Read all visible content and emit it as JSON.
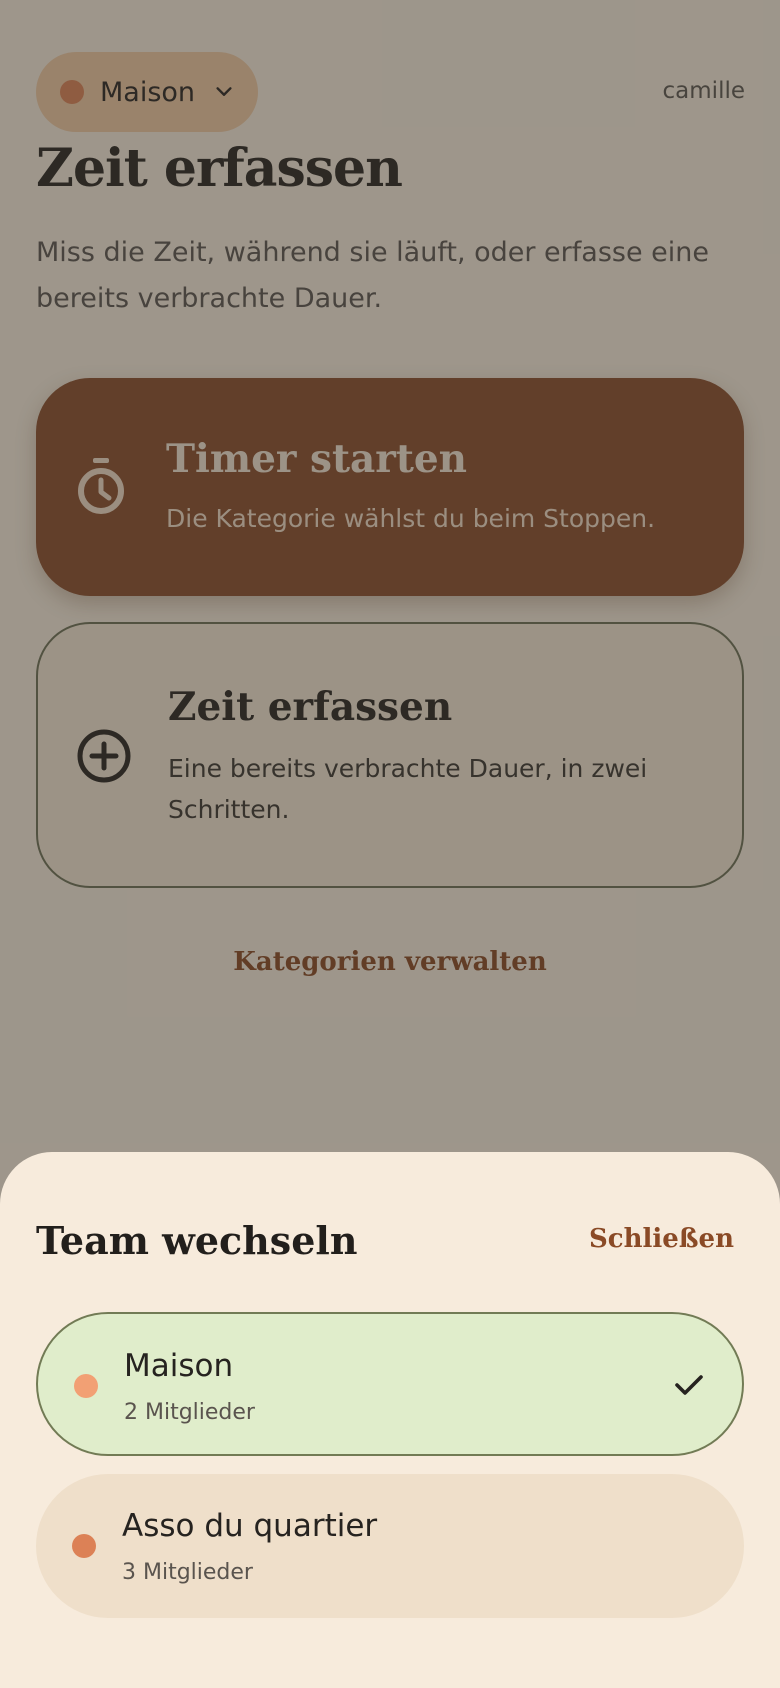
{
  "header": {
    "team_name": "Maison",
    "team_color": "#dc8156",
    "user_name": "camille"
  },
  "main": {
    "title": "Zeit erfassen",
    "subtitle": "Miss die Zeit, während sie läuft, oder erfasse eine bereits verbrachte Dauer.",
    "timer_card": {
      "icon": "stopwatch-icon",
      "title": "Timer starten",
      "description": "Die Kategorie wählst du beim Stoppen."
    },
    "manual_card": {
      "icon": "plus-circle-icon",
      "title": "Zeit erfassen",
      "description": "Eine bereits verbrachte Dauer, in zwei Schritten."
    },
    "manage_categories_label": "Kategorien verwalten"
  },
  "sheet": {
    "title": "Team wechseln",
    "close_label": "Schließen",
    "teams": [
      {
        "name": "Maison",
        "members": "2 Mitglieder",
        "color": "#f2a074",
        "selected": true
      },
      {
        "name": "Asso du quartier",
        "members": "3 Mitglieder",
        "color": "#dc8156",
        "selected": false
      }
    ]
  },
  "colors": {
    "accent": "#8a4d2c",
    "selected_bg": "#e0edcb",
    "sheet_bg": "#f7ebdc"
  }
}
